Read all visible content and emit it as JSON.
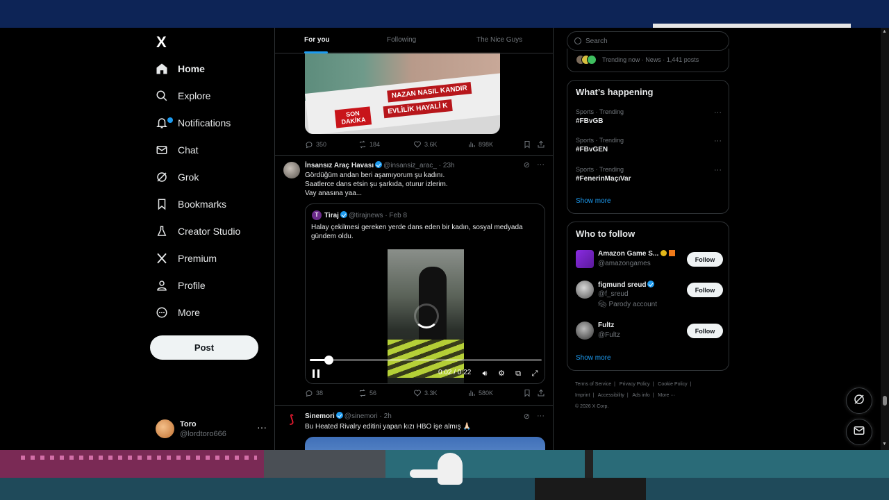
{
  "colors": {
    "accent": "#1d9bf0",
    "background": "#000000",
    "text": "#e7e9ea",
    "muted": "#71767b"
  },
  "sidebar": {
    "logo": "X",
    "items": [
      {
        "label": "Home",
        "icon": "home-icon"
      },
      {
        "label": "Explore",
        "icon": "search-icon"
      },
      {
        "label": "Notifications",
        "icon": "bell-icon"
      },
      {
        "label": "Chat",
        "icon": "mail-icon"
      },
      {
        "label": "Grok",
        "icon": "grok-icon"
      },
      {
        "label": "Bookmarks",
        "icon": "bookmark-icon"
      },
      {
        "label": "Creator Studio",
        "icon": "flask-icon"
      },
      {
        "label": "Premium",
        "icon": "x-logo-icon"
      },
      {
        "label": "Profile",
        "icon": "person-icon"
      },
      {
        "label": "More",
        "icon": "more-circle-icon"
      }
    ],
    "post_button": "Post",
    "account": {
      "name": "Toro",
      "handle": "@lordtoro666",
      "more": "···"
    }
  },
  "tabs": [
    {
      "label": "For you",
      "active": true
    },
    {
      "label": "Following",
      "active": false
    },
    {
      "label": "The Nice Guys",
      "active": false
    }
  ],
  "post1": {
    "image_text": {
      "line1": "NAZAN NASIL KANDIR",
      "line2": "EVLİLİK HAYALİ K",
      "badge1": "SON",
      "badge2": "DAKİKA"
    },
    "stats": {
      "replies": "350",
      "reposts": "184",
      "likes": "3.6K",
      "views": "898K"
    }
  },
  "post2": {
    "author": "İnsansız Araç Havası",
    "handle": "@insansiz_arac_",
    "time": "· 23h",
    "text": [
      "Gördüğüm andan beri aşamıyorum şu kadını.",
      "Saatlerce dans etsin şu şarkıda, oturur izlerim.",
      "Vay anasına yaa..."
    ],
    "quote": {
      "avatar": "T",
      "author": "Tiraj",
      "handle": "@tirajnews",
      "time": "· Feb 8",
      "text": "Halay çekilmesi gereken yerde dans eden bir kadın, sosyal medyada gündem oldu."
    },
    "video": {
      "time": "0:02 / 0:22",
      "progress": 0.08
    },
    "stats": {
      "replies": "38",
      "reposts": "56",
      "likes": "3.3K",
      "views": "580K"
    }
  },
  "post3": {
    "author": "Sinemori",
    "handle": "@sinemori",
    "time": "· 2h",
    "text": "Bu Heated Rivalry editini yapan kızı HBO işe almış 🙏🏻"
  },
  "right": {
    "search_placeholder": "Search",
    "news_meta": "Trending now · News · 1,441 posts",
    "happening": {
      "title": "What’s happening",
      "trends": [
        {
          "category": "Sports · Trending",
          "tag": "#FBvGB"
        },
        {
          "category": "Sports · Trending",
          "tag": "#FBvGEN"
        },
        {
          "category": "Sports · Trending",
          "tag": "#FenerinMaçıVar"
        }
      ],
      "show_more": "Show more"
    },
    "who_to_follow": {
      "title": "Who to follow",
      "accounts": [
        {
          "name": "Amazon Game S...",
          "handle": "@amazongames",
          "note": "",
          "button": "Follow"
        },
        {
          "name": "figmund sreud",
          "handle": "@f_sreud",
          "note": "Parody account",
          "button": "Follow"
        },
        {
          "name": "Fultz",
          "handle": "@Fultz",
          "note": "",
          "button": "Follow"
        }
      ],
      "show_more": "Show more"
    },
    "footer": [
      "Terms of Service",
      "|",
      "Privacy Policy",
      "|",
      "Cookie Policy",
      "|",
      "Imprint",
      "|",
      "Accessibility",
      "|",
      "Ads info",
      "|",
      "More ···",
      "© 2026 X Corp."
    ]
  }
}
